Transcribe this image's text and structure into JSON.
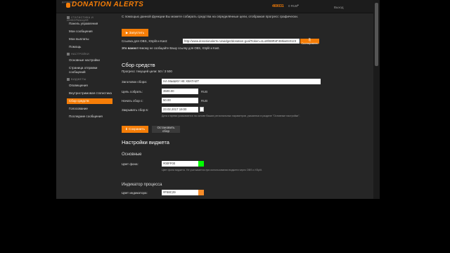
{
  "topbar": {
    "left_text": "доналерты",
    "logo": "DONATION ALERTS",
    "balance": "469031",
    "currency": "0 RUB",
    "user": "•",
    "exit": "Выход"
  },
  "sidebar": {
    "sections": [
      {
        "label": "СТАТИСТИКА И ИНФОРМАЦИЯ"
      },
      {
        "label": "НАСТРОЙКИ"
      },
      {
        "label": "ВИДЖЕТЫ"
      }
    ],
    "items": [
      {
        "label": "Панель управления"
      },
      {
        "label": "Мои сообщения"
      },
      {
        "label": "Мои выплаты"
      },
      {
        "label": "Помощь"
      },
      {
        "label": "Основные настройки"
      },
      {
        "label": "Страница отправки"
      },
      {
        "label": "сообщений"
      },
      {
        "label": "Оповещения"
      },
      {
        "label": "Внутристримовая статистика"
      },
      {
        "label": "Сбор средств"
      },
      {
        "label": "Голосование"
      },
      {
        "label": "Последние сообщения"
      }
    ]
  },
  "main": {
    "intro": "С помощью данной функции Вы можете собирать средства на определённые цели, отображая прогресс графически.",
    "launch_button": "▶ Запустить",
    "obs_link_label": "Ссылка для OBS, XSplit и Kast:",
    "obs_link_value": "http://www.donationalerts.ru/widget/donation-goal?token=sLo8h59R4F4Mkw0c0123",
    "copy_button": "⎘ Скопировать",
    "warning_bold": "Это важно!",
    "warning_text": "Никому не сообщайте Вашу ссылку для OBS, XSplit и Kast.",
    "section_title": "Сбор средств",
    "progress_label": "Прогресс текущей цели:",
    "progress_value": "50 / 3 500",
    "form": {
      "title_label": "Заголовок сбора:",
      "title_value": "НА МЫШКУ НЕ ХВАТАЕТ",
      "goal_label": "Цель собрать:",
      "goal_value": "3500.00",
      "start_label": "Начать сбор с:",
      "start_value": "50.00",
      "end_label": "Закрывать сбор в:",
      "end_value": "23.02.2017 19:00",
      "unit": "RUB",
      "date_note": "Дата и время указываются на основе Ваших региональных параметров, указанных в разделе \"Основные настройки\"."
    },
    "save_button": "⬇ Сохранить",
    "stop_button": "Остановить сбор",
    "widget_title": "Настройки виджета",
    "basic_title": "Основные",
    "bg_color_label": "Цвет фона:",
    "bg_color_value": "#00FF00",
    "bg_color_note": "Цвет фона виджета. Не учитывается при использовании виджета через OBS и XSplit.",
    "progress_title": "Индикатор процесса",
    "indicator_color_label": "Цвет индикатора:",
    "indicator_color_value": "#F88C29"
  },
  "colors": {
    "accent": "#f57d07",
    "bg_swatch": "#00ff00",
    "indicator_swatch": "#f88c29"
  }
}
